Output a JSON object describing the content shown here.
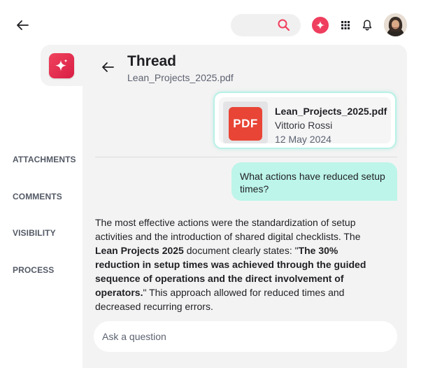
{
  "thread": {
    "title": "Thread",
    "subtitle": "Lean_Projects_2025.pdf"
  },
  "sidebar": {
    "items": [
      {
        "label": "ATTACHMENTS"
      },
      {
        "label": "COMMENTS"
      },
      {
        "label": "VISIBILITY"
      },
      {
        "label": "PROCESS"
      }
    ]
  },
  "file_card": {
    "badge": "PDF",
    "name": "Lean_Projects_2025.pdf",
    "author": "Vittorio Rossi",
    "date": "12 May 2024"
  },
  "question": "What actions have reduced setup times?",
  "answer": {
    "p1": "The most effective actions were the standardization of setup activities and the introduction of shared digital checklists. The ",
    "doc": "Lean Projects 2025",
    "p2": " document clearly states: \"",
    "quote": "The 30% reduction in setup times was achieved through the guided sequence of operations and the direct involvement of operators.",
    "p3": "\" This approach allowed for reduced times and decreased recurring errors."
  },
  "input": {
    "placeholder": "Ask a question"
  },
  "colors": {
    "accent": "#ef3e5e",
    "bubble": "#bdf5ea",
    "pdf": "#e84536"
  }
}
